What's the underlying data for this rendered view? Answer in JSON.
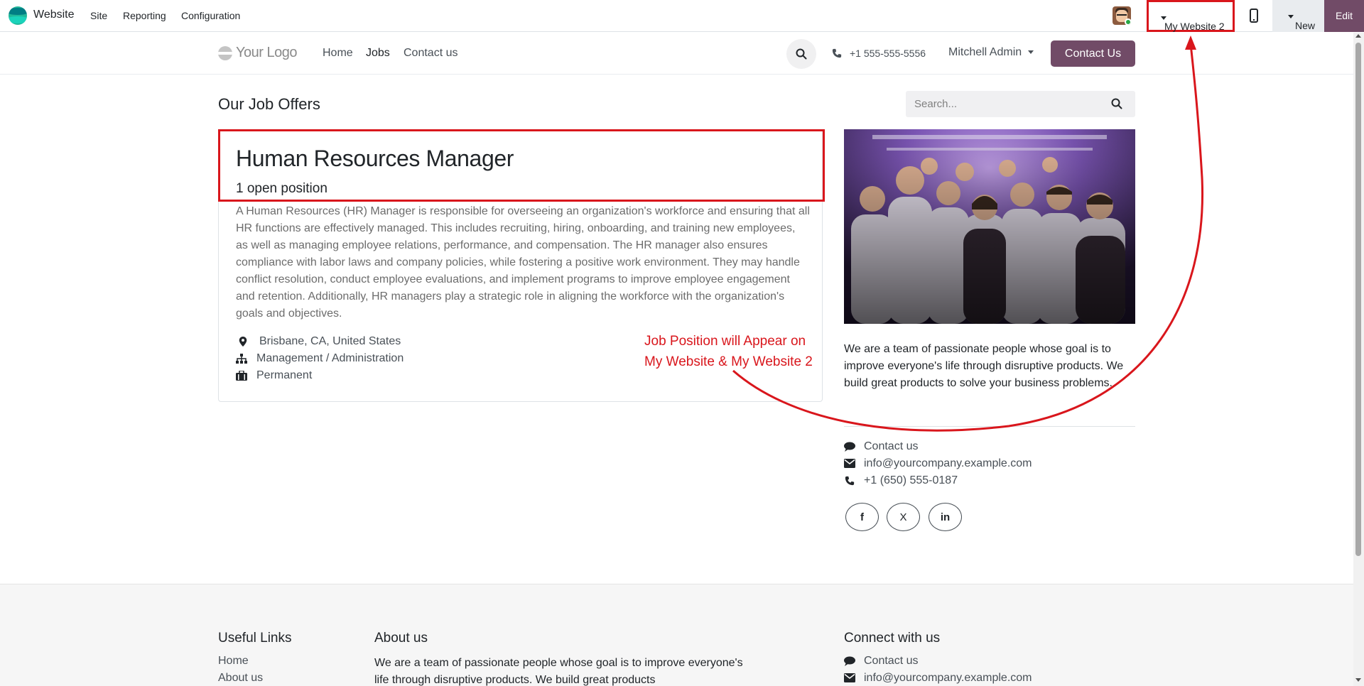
{
  "topbar": {
    "app_name": "Website",
    "menus": [
      "Site",
      "Reporting",
      "Configuration"
    ],
    "website_selector": "My Website 2",
    "new_label": "New",
    "edit_label": "Edit"
  },
  "site_header": {
    "logo_text": "Your Logo",
    "nav": [
      "Home",
      "Jobs",
      "Contact us"
    ],
    "active_nav": "Jobs",
    "phone": "+1 555-555-5556",
    "user": "Mitchell Admin",
    "cta": "Contact Us"
  },
  "main": {
    "title": "Our Job Offers",
    "search_placeholder": "Search...",
    "job": {
      "title": "Human Resources Manager",
      "open_positions": "1 open position",
      "description": "A Human Resources (HR) Manager is responsible for overseeing an organization's workforce and ensuring that all HR functions are effectively managed. This includes recruiting, hiring, onboarding, and training new employees, as well as managing employee relations, performance, and compensation. The HR manager also ensures compliance with labor laws and company policies, while fostering a positive work environment. They may handle conflict resolution, conduct employee evaluations, and implement programs to improve employee engagement and retention. Additionally, HR managers play a strategic role in aligning the workforce with the organization's goals and objectives.",
      "location": "Brisbane, CA, United States",
      "department": "Management / Administration",
      "employment_type": "Permanent"
    },
    "annotation_line1": "Job Position will Appear on",
    "annotation_line2": "My Website & My Website 2"
  },
  "sidebar": {
    "about": "We are a team of passionate people whose goal is to improve everyone's life through disruptive products. We build great products to solve your business problems.",
    "contact_label": "Contact us",
    "email": "info@yourcompany.example.com",
    "phone": "+1 (650) 555-0187",
    "social": [
      "f",
      "X",
      "in"
    ]
  },
  "footer": {
    "useful_links_title": "Useful Links",
    "useful_links": [
      "Home",
      "About us"
    ],
    "about_title": "About us",
    "about_text": "We are a team of passionate people whose goal is to improve everyone's life through disruptive products. We build great products",
    "connect_title": "Connect with us",
    "connect_contact": "Contact us",
    "connect_email": "info@yourcompany.example.com"
  },
  "colors": {
    "brand": "#714b67",
    "annotation": "#d9161c"
  }
}
